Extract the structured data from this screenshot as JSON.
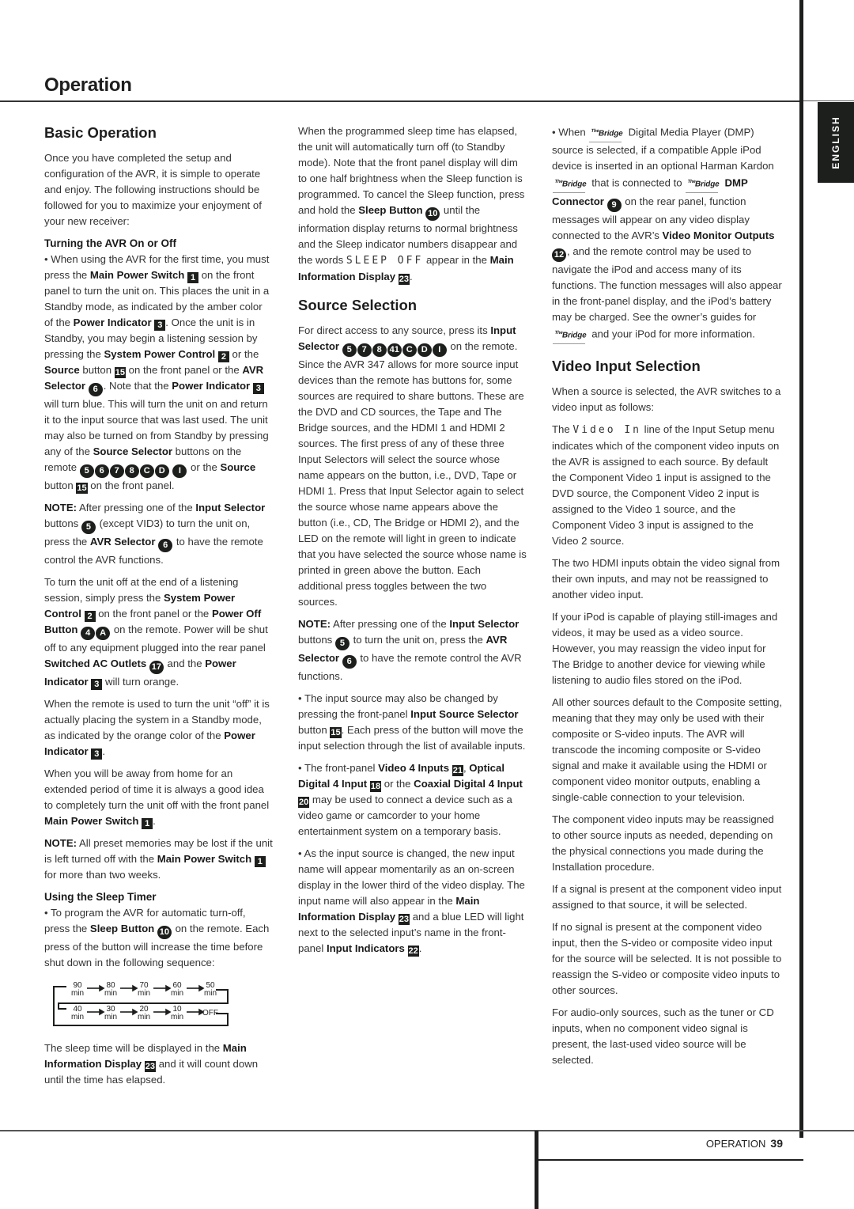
{
  "page": {
    "title": "Operation",
    "language_tab": "ENGLISH",
    "footer": {
      "section": "OPERATION",
      "page_number": "39"
    }
  },
  "col1": {
    "heading": "Basic Operation",
    "intro": "Once you have completed the setup and configuration of the AVR, it is simple to operate and enjoy. The following instructions should be followed for you to maximize your enjoyment of your new receiver:",
    "turning_heading": "Turning the AVR On or Off",
    "p1": {
      "a": "• When using the AVR for the first time, you must press the ",
      "b1": "Main Power Switch",
      "n1": "1",
      "c": " on the front panel to turn the unit on. This places the unit in a Standby mode, as indicated by the amber color of the ",
      "b2": "Power Indicator",
      "n2": "3",
      "d": ". Once the unit is in Standby, you may begin a listening session by pressing the ",
      "b3": "System Power Control",
      "n3": "2",
      "e": " or the ",
      "b4": "Source",
      "f": " button ",
      "n4": "15",
      "g": " on the front panel or the ",
      "b5": "AVR Selector",
      "n5": "6",
      "h": ". Note that the ",
      "b6": "Power Indicator",
      "n6": "3",
      "i": " will turn blue. This will turn the unit on and return it to the input source that was last used. The unit may also be turned on from Standby by pressing any of the ",
      "b7": "Source Selector",
      "j": " buttons on the remote ",
      "remote_buttons": [
        "5",
        "6",
        "7",
        "8",
        "C",
        "D",
        "I"
      ],
      "k": " or the ",
      "b8": "Source",
      "l": " button ",
      "n8": "15",
      "m": " on the front panel."
    },
    "note1": {
      "label": "NOTE:",
      "a": " After pressing one of the ",
      "b1": "Input Selector",
      "b": " buttons ",
      "n1": "5",
      "c": " (except VID3) to turn the unit on, press the ",
      "b2": "AVR Selector",
      "n2": "6",
      "d": " to have the remote control the AVR functions."
    },
    "p2": {
      "a": "To turn the unit off at the end of a listening session, simply press the ",
      "b1": "System Power Control",
      "n1": "2",
      "b": " on the front panel or the ",
      "b2": "Power Off Button",
      "n2a": "4",
      "n2b": "A",
      "c": " on the remote. Power will be shut off to any equipment plugged into the rear panel ",
      "b3": "Switched AC Outlets",
      "n3": "17",
      "d": " and the ",
      "b4": "Power Indicator",
      "n4": "3",
      "e": " will turn orange."
    },
    "p3": {
      "a": "When the remote is used to turn the unit “off” it is actually placing the system in a Standby mode, as indicated by the orange color of the ",
      "b1": "Power Indicator",
      "n1": "3",
      "b": "."
    },
    "p4": {
      "a": "When you will be away from home for an extended period of time it is always a good idea to completely turn the unit off with the front panel ",
      "b1": "Main Power Switch",
      "n1": "1",
      "b": "."
    },
    "note2": {
      "label": "NOTE:",
      "a": " All preset memories may be lost if the unit is left turned off with the ",
      "b1": "Main Power Switch",
      "n1": "1",
      "b": " for more than two weeks."
    },
    "sleep_heading": "Using the Sleep Timer",
    "p5": {
      "a": "• To program the AVR for automatic turn-off, press the ",
      "b1": "Sleep Button",
      "n1": "10",
      "b": " on the remote. Each press of the button will increase the time before shut down in the following sequence:"
    },
    "sleep_sequence": [
      {
        "v": "90",
        "u": "min"
      },
      {
        "v": "80",
        "u": "min"
      },
      {
        "v": "70",
        "u": "min"
      },
      {
        "v": "60",
        "u": "min"
      },
      {
        "v": "50",
        "u": "min"
      },
      {
        "v": "40",
        "u": "min"
      },
      {
        "v": "30",
        "u": "min"
      },
      {
        "v": "20",
        "u": "min"
      },
      {
        "v": "10",
        "u": "min"
      },
      {
        "v": "OFF",
        "u": ""
      }
    ],
    "p6": {
      "a": "The sleep time will be displayed in the ",
      "b1": "Main Information Display",
      "n1": "23",
      "b": " and it will count down until the time has elapsed."
    }
  },
  "col2": {
    "p1": {
      "a": "When the programmed sleep time has elapsed, the unit will automatically turn off (to Standby mode). Note that the front panel display will dim to one half brightness when the Sleep function is programmed. To cancel the Sleep function, press and hold the ",
      "b1": "Sleep Button",
      "n1": "10",
      "b": " until the information display returns to normal brightness and the Sleep indicator numbers disappear and the words ",
      "lcd": "SLEEP OFF",
      "c": " appear in the ",
      "b2": "Main Information Display",
      "n2": "23",
      "d": "."
    },
    "heading": "Source Selection",
    "p2": {
      "a": "For direct access to any source, press its ",
      "b1": "Input Selector",
      "buttons": [
        "5",
        "7",
        "8",
        "41",
        "C",
        "D",
        "I"
      ],
      "b": " on the remote. Since the AVR 347 allows for more source input devices than the remote has buttons for, some sources are required to share buttons. These are the DVD and CD sources, the Tape and The Bridge sources, and the HDMI 1 and HDMI 2 sources. The first press of any of these three Input Selectors will select the source whose name appears on the button, i.e., DVD, Tape or HDMI 1. Press that Input Selector again to select the source whose name appears above the button (i.e., CD, The Bridge or HDMI 2), and the LED on the remote will light in green to indicate that you have selected the source whose name is printed in green above the button. Each additional press toggles between the two sources."
    },
    "note": {
      "label": "NOTE:",
      "a": " After pressing one of the ",
      "b1": "Input Selector",
      "b": " buttons ",
      "n1": "5",
      "c": " to turn the unit on, press the ",
      "b2": "AVR Selector",
      "n2": "6",
      "d": " to have the remote control the AVR functions."
    },
    "p3": {
      "a": "• The input source may also be changed by pressing the front-panel ",
      "b1": "Input Source Selector",
      "b": " button ",
      "n1": "15",
      "c": ". Each press of the button will move the input selection through the list of available inputs."
    },
    "p4": {
      "a": "• The front-panel ",
      "b1": "Video 4 Inputs",
      "n1": "21",
      "b": ", ",
      "b2": "Optical Digital 4 Input",
      "n2": "18",
      "c": " or the ",
      "b3": "Coaxial Digital 4 Input",
      "n3": "20",
      "d": " may be used to connect a device such as a video game or camcorder to your home entertainment system on a temporary basis."
    },
    "p5": {
      "a": "• As the input source is changed, the new input name will appear momentarily as an on-screen display in the lower third of the video display. The input name will also appear in the ",
      "b1": "Main Information Display",
      "n1": "23",
      "b": " and a blue LED will light next to the selected input’s name in the front-panel ",
      "b2": "Input Indicators",
      "n2": "22",
      "c": "."
    }
  },
  "col3": {
    "bridge_logo": "Bridge",
    "bridge_prefix": "The",
    "p1": {
      "a": "• When ",
      "b": " Digital Media Player (DMP) source is selected, if a compatible Apple iPod device is inserted in an optional Harman Kardon ",
      "c": " that is connected to ",
      "b1": "DMP Connector",
      "n1": "9",
      "d": " on the rear panel, function messages will appear on any video display connected to the AVR’s ",
      "b2": "Video Monitor Outputs",
      "n2": "12",
      "e": ", and the remote control may be used to navigate the iPod and access many of its functions. The function messages will also appear in the front-panel display, and the iPod’s battery may be charged. See the owner’s guides for ",
      "f": " and your iPod for more information."
    },
    "heading": "Video Input Selection",
    "p2": "When a source is selected, the AVR switches to a video input as follows:",
    "p3": {
      "a": "The ",
      "lcd": "Video In",
      "b": " line of the Input Setup menu indicates which of the component video inputs on the AVR is assigned to each source. By default the Component Video 1 input is assigned to the DVD source, the Component Video 2 input is assigned to the Video 1 source, and the Component Video 3 input is assigned to the Video 2 source."
    },
    "p4": "The two HDMI inputs obtain the video signal from their own inputs, and may not be reassigned to another video input.",
    "p5": "If your iPod is capable of playing still-images and videos, it may be used as a video source. However, you may reassign the video input for The Bridge to another device for viewing while listening to audio files stored on the iPod.",
    "p6": "All other sources default to the Composite setting, meaning that they may only be used with their composite or S-video inputs. The AVR will transcode the incoming composite or S-video signal and make it available using the HDMI or component video monitor outputs, enabling a single-cable connection to your television.",
    "p7": "The component video inputs may be reassigned to other source inputs as needed, depending on the physical connections you made during the Installation procedure.",
    "p8": "If a signal is present at the component video input assigned to that source, it will be selected.",
    "p9": "If no signal is present at the component video input, then the S-video or composite video input for the source will be selected. It is not possible to reassign the S-video or composite video inputs to other sources.",
    "p10": "For audio-only sources, such as the tuner or CD inputs, when no component video signal is present, the last-used video source will be selected."
  }
}
